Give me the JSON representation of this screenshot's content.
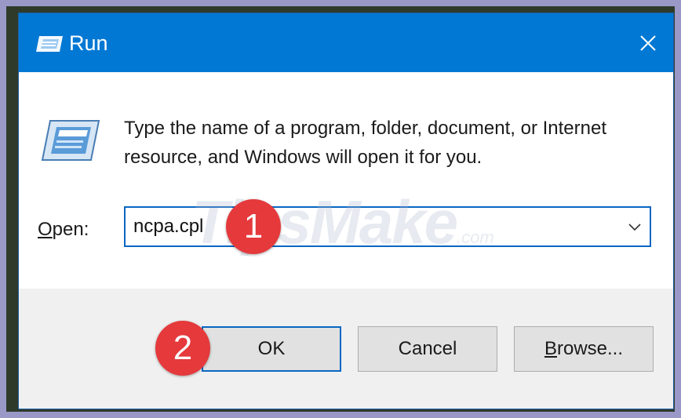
{
  "window": {
    "title": "Run",
    "title_icon": "run-icon",
    "close_glyph": "✕"
  },
  "content": {
    "icon": "run-program-icon",
    "description": "Type the name of a program, folder, document, or Internet resource, and Windows will open it for you.",
    "open_label_access_key": "O",
    "open_label_rest": "pen:",
    "open_value": "ncpa.cpl"
  },
  "buttons": {
    "ok_label": "OK",
    "cancel_label": "Cancel",
    "browse_access_key": "B",
    "browse_label_rest": "rowse..."
  },
  "annotations": {
    "step1": "1",
    "step2": "2"
  },
  "watermark": {
    "text": "TipsMake",
    "suffix": ".com"
  },
  "colors": {
    "titlebar": "#0078d4",
    "accent_border": "#0a66c2",
    "step_badge": "#e5393c",
    "footer": "#f0f0f0"
  }
}
